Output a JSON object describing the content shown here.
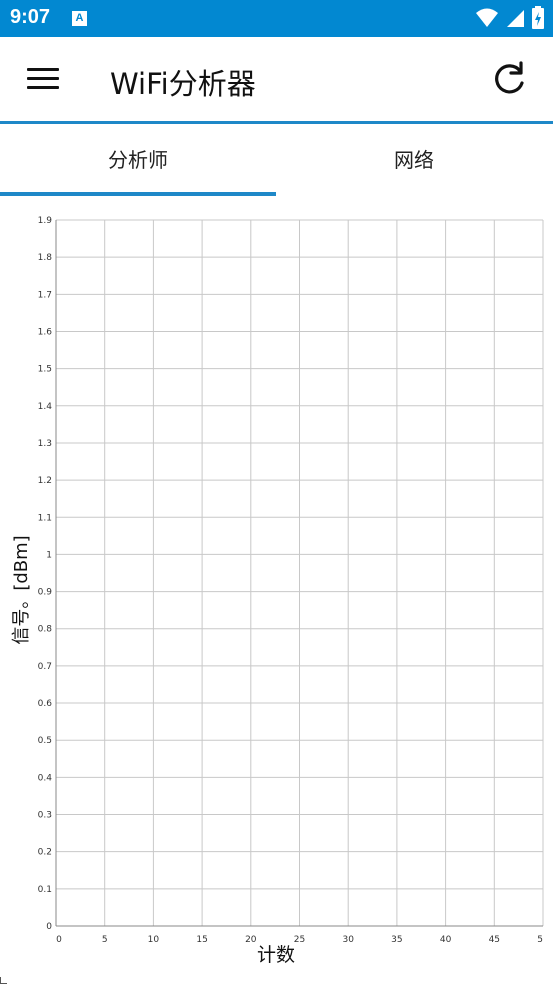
{
  "status": {
    "time": "9:07",
    "app_icon_letter": "A"
  },
  "appbar": {
    "title": "WiFi分析器"
  },
  "tabs": [
    {
      "label": "分析师",
      "selected": true
    },
    {
      "label": "网络",
      "selected": false
    }
  ],
  "colors": {
    "status_bar": "#0288d1",
    "accent": "#1e88c8",
    "grid": "#c8c8c8"
  },
  "chart_data": {
    "type": "line",
    "xlabel": "计数",
    "ylabel": "信号。[dBm]",
    "xlim": [
      0,
      50
    ],
    "ylim": [
      0,
      1.9
    ],
    "x_ticks": [
      "0",
      "5",
      "10",
      "15",
      "20",
      "25",
      "30",
      "35",
      "40",
      "45",
      "5"
    ],
    "y_ticks": [
      "0",
      "0.1",
      "0.2",
      "0.3",
      "0.4",
      "0.5",
      "0.6",
      "0.7",
      "0.8",
      "0.9",
      "1",
      "1.1",
      "1.2",
      "1.3",
      "1.4",
      "1.5",
      "1.6",
      "1.7",
      "1.8",
      "1.9"
    ],
    "grid": true,
    "series": []
  }
}
